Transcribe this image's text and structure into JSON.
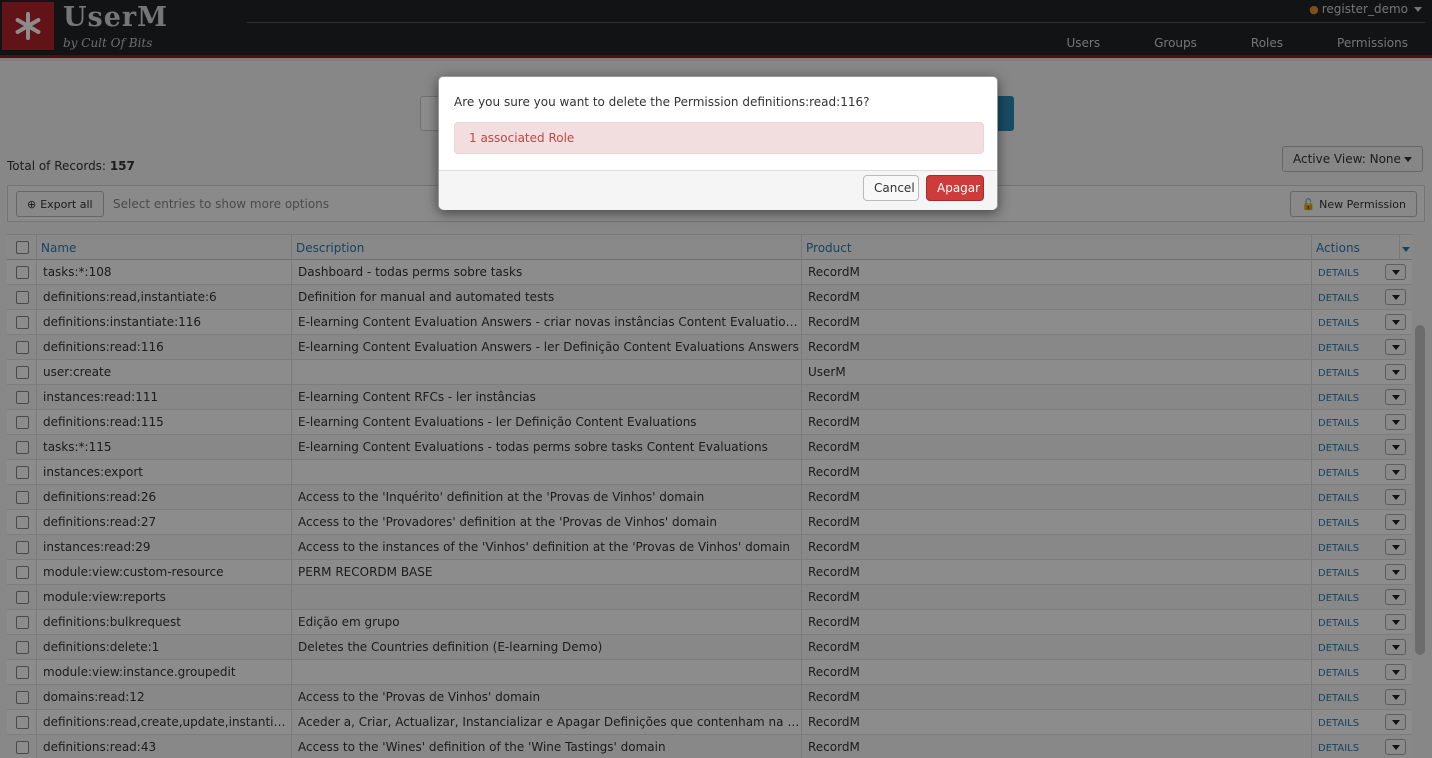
{
  "app": {
    "title": "UserM",
    "subtitle": "by Cult Of Bits",
    "user": "register_demo"
  },
  "nav": [
    "Users",
    "Groups",
    "Roles",
    "Permissions"
  ],
  "page": {
    "total_label": "Total of Records:",
    "total_value": "157",
    "active_view_label": "Active View: None",
    "export_label": "Export all",
    "hint": "Select entries to show more options",
    "new_label": "New Permission"
  },
  "table": {
    "columns": [
      "Name",
      "Description",
      "Product",
      "Actions"
    ],
    "details_label": "DETAILS",
    "rows": [
      {
        "name": "tasks:*:108",
        "description": "Dashboard - todas perms sobre tasks",
        "product": "RecordM"
      },
      {
        "name": "definitions:read,instantiate:6",
        "description": "Definition for manual and automated tests",
        "product": "RecordM"
      },
      {
        "name": "definitions:instantiate:116",
        "description": "E-learning Content Evaluation Answers - criar novas instâncias Content Evaluations Answers",
        "product": "RecordM"
      },
      {
        "name": "definitions:read:116",
        "description": "E-learning Content Evaluation Answers - ler Definição Content Evaluations Answers",
        "product": "RecordM"
      },
      {
        "name": "user:create",
        "description": "",
        "product": "UserM"
      },
      {
        "name": "instances:read:111",
        "description": "E-learning Content RFCs - ler instâncias",
        "product": "RecordM"
      },
      {
        "name": "definitions:read:115",
        "description": "E-learning Content Evaluations - ler Definição Content Evaluations",
        "product": "RecordM"
      },
      {
        "name": "tasks:*:115",
        "description": "E-learning Content Evaluations - todas perms sobre tasks Content Evaluations",
        "product": "RecordM"
      },
      {
        "name": "instances:export",
        "description": "",
        "product": "RecordM"
      },
      {
        "name": "definitions:read:26",
        "description": "Access to the 'Inquérito' definition at the 'Provas de Vinhos' domain",
        "product": "RecordM"
      },
      {
        "name": "definitions:read:27",
        "description": "Access to the 'Provadores' definition at the 'Provas de Vinhos' domain",
        "product": "RecordM"
      },
      {
        "name": "instances:read:29",
        "description": "Access to the instances of the 'Vinhos' definition at the 'Provas de Vinhos' domain",
        "product": "RecordM"
      },
      {
        "name": "module:view:custom-resource",
        "description": "PERM RECORDM BASE",
        "product": "RecordM"
      },
      {
        "name": "module:view:reports",
        "description": "",
        "product": "RecordM"
      },
      {
        "name": "definitions:bulkrequest",
        "description": "Edição em grupo",
        "product": "RecordM"
      },
      {
        "name": "definitions:delete:1",
        "description": "Deletes the Countries definition (E-learning Demo)",
        "product": "RecordM"
      },
      {
        "name": "module:view:instance.groupedit",
        "description": "",
        "product": "RecordM"
      },
      {
        "name": "domains:read:12",
        "description": "Access to the 'Provas de Vinhos' domain",
        "product": "RecordM"
      },
      {
        "name": "definitions:read,create,update,instantiate,...",
        "description": "Aceder a, Criar, Actualizar, Instancializar e Apagar Definições que contenham na descrição...",
        "product": "RecordM"
      },
      {
        "name": "definitions:read:43",
        "description": "Access to the 'Wines' definition of the 'Wine Tastings' domain",
        "product": "RecordM"
      }
    ]
  },
  "modal": {
    "question": "Are you sure you want to delete the Permission definitions:read:116?",
    "alert": "1 associated Role",
    "cancel_label": "Cancel",
    "confirm_label": "Apagar"
  },
  "colors": {
    "header_bg": "#1f2326",
    "brand_red": "#b2232b",
    "link_blue": "#2a7ab0",
    "danger": "#cd3b3b"
  }
}
